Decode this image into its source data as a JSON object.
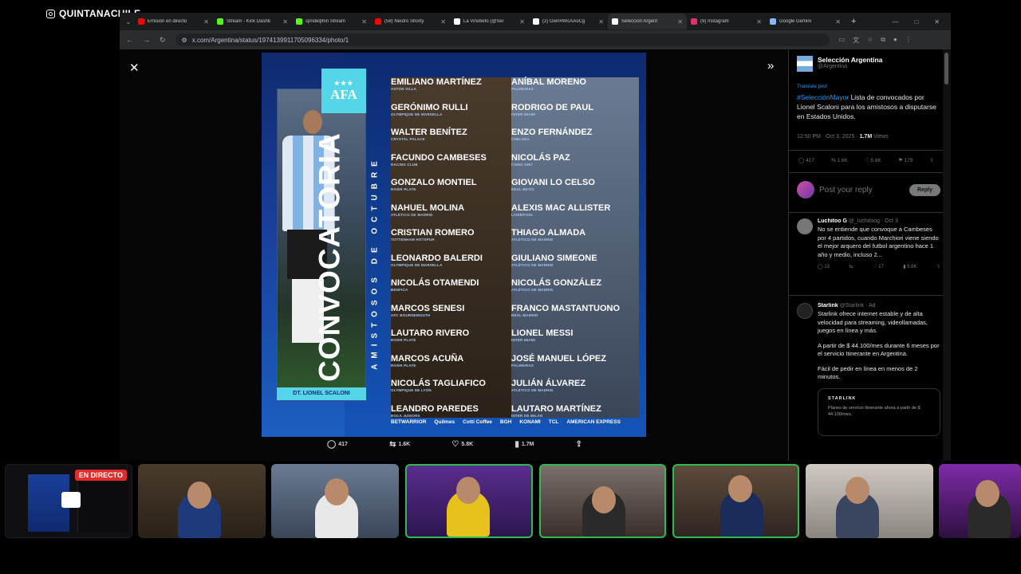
{
  "stream": {
    "channel": "QUINTANACHILE",
    "live_badge": "EN DIRECTO"
  },
  "browser": {
    "tabs": [
      {
        "label": "Emisión en directo",
        "color": "#ff0000"
      },
      {
        "label": "Stream - Kick Dashb",
        "color": "#53fc18"
      },
      {
        "label": "spndelphin Stream",
        "color": "#53fc18"
      },
      {
        "label": "(58) Neutro Shorty",
        "color": "#ff0000"
      },
      {
        "label": "La Vinotieto (@Sel",
        "color": "#ffffff"
      },
      {
        "label": "(2) GwnRWcAAoCg",
        "color": "#ffffff"
      },
      {
        "label": "Selección Argent",
        "color": "#ffffff"
      },
      {
        "label": "(9) Instagram",
        "color": "#e1306c"
      },
      {
        "label": "Google Gemini",
        "color": "#8ab4f8"
      }
    ],
    "url": "x.com/Argentina/status/1974139911705096334/photo/1"
  },
  "poster": {
    "title": "CONVOCATORIA",
    "subtitle": "AMISTOSOS DE OCTUBRE",
    "badge": "AFA",
    "coach": "DT. LIONEL SCALONI",
    "players_left": [
      {
        "name": "EMILIANO MARTÍNEZ",
        "club": "ASTON VILLA"
      },
      {
        "name": "GERÓNIMO RULLI",
        "club": "OLYMPIQUE DE MARSELLA"
      },
      {
        "name": "WALTER BENÍTEZ",
        "club": "CRYSTAL PALACE"
      },
      {
        "name": "FACUNDO CAMBESES",
        "club": "RACING CLUB"
      },
      {
        "name": "GONZALO MONTIEL",
        "club": "RIVER PLATE"
      },
      {
        "name": "NAHUEL MOLINA",
        "club": "ATLÉTICO DE MADRID"
      },
      {
        "name": "CRISTIAN ROMERO",
        "club": "TOTTENHAM HOTSPUR"
      },
      {
        "name": "LEONARDO BALERDI",
        "club": "OLYMPIQUE DE MARSELLA"
      },
      {
        "name": "NICOLÁS OTAMENDI",
        "club": "BENFICA"
      },
      {
        "name": "MARCOS SENESI",
        "club": "AFC BOURNEMOUTH"
      },
      {
        "name": "LAUTARO RIVERO",
        "club": "RIVER PLATE"
      },
      {
        "name": "MARCOS ACUÑA",
        "club": "RIVER PLATE"
      },
      {
        "name": "NICOLÁS TAGLIAFICO",
        "club": "OLYMPIQUE DE LYON"
      },
      {
        "name": "LEANDRO PAREDES",
        "club": "BOCA JUNIORS"
      }
    ],
    "players_right": [
      {
        "name": "ANÍBAL MORENO",
        "club": "PALMEIRAS"
      },
      {
        "name": "RODRIGO DE PAUL",
        "club": "INTER MIAMI"
      },
      {
        "name": "ENZO FERNÁNDEZ",
        "club": "CHELSEA"
      },
      {
        "name": "NICOLÁS PAZ",
        "club": "COMO 1907"
      },
      {
        "name": "GIOVANI LO CELSO",
        "club": "REAL BETIS"
      },
      {
        "name": "ALEXIS MAC ALLISTER",
        "club": "LIVERPOOL"
      },
      {
        "name": "THIAGO ALMADA",
        "club": "ATLÉTICO DE MADRID"
      },
      {
        "name": "GIULIANO SIMEONE",
        "club": "ATLÉTICO DE MADRID"
      },
      {
        "name": "NICOLÁS GONZÁLEZ",
        "club": "ATLÉTICO DE MADRID"
      },
      {
        "name": "FRANCO MASTANTUONO",
        "club": "REAL MADRID"
      },
      {
        "name": "LIONEL MESSI",
        "club": "INTER MIAMI"
      },
      {
        "name": "JOSÉ MANUEL LÓPEZ",
        "club": "PALMEIRAS"
      },
      {
        "name": "JULIÁN ÁLVAREZ",
        "club": "ATLÉTICO DE MADRID"
      },
      {
        "name": "LAUTARO MARTÍNEZ",
        "club": "INTER DE MILÁN"
      }
    ],
    "sponsors": [
      "BETWARRIOR",
      "Quilmes",
      "Cotti Coffee",
      "BGH",
      "KONAMI",
      "TCL",
      "AMERICAN EXPRESS"
    ]
  },
  "viewer_actions": {
    "replies": "417",
    "reposts": "1.6K",
    "likes": "5.8K",
    "views": "1.7M"
  },
  "tweet": {
    "author_name": "Selección Argentina",
    "handle": "@Argentina",
    "translate": "Translate post",
    "hashtag": "#SelecciónMayor",
    "text": " Lista de convocados por Lionel Scaloni para los amistosos a disputarse en Estados Unidos.",
    "time": "12:50 PM · Oct 3, 2025 · ",
    "views": "1.7M",
    "views_label": " Views",
    "replies": "417",
    "reposts": "1.6K",
    "likes": "5.8K",
    "bookmarks": "179",
    "reply_placeholder": "Post your reply",
    "reply_button": "Reply"
  },
  "comments": [
    {
      "name": "Luchitoo G",
      "handle": "@_luchitoog · Oct 3",
      "text": "No se entiende que convoque a Cambeses por 4 partidos, cuando Marchiori viene siendo el mejor arquero del futbol argentino hace 1 año y medio, incluso 2...",
      "replies": "13",
      "likes": "17",
      "views": "5.8K"
    },
    {
      "name": "Starlink",
      "handle": "@Starlink",
      "ad": "Ad",
      "text": "Starlink ofrece internet estable y de alta velocidad para streaming, videollamadas, juegos en línea y más.",
      "text2": "A partir de $ 44.100/mes durante 6 meses por el servicio Itinerante en Argentina.",
      "text3": "Fácil de pedir en línea en menos de 2 minutos.",
      "card_title": "STARLINK",
      "card_text": "Planes de servicio Itinerante ahora a partir de $ 44.100/mes,"
    }
  ]
}
